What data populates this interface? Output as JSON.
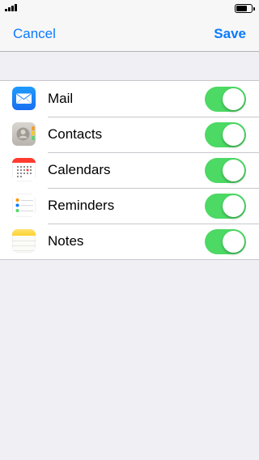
{
  "nav": {
    "cancel_label": "Cancel",
    "save_label": "Save"
  },
  "accent_color": "#0a7aff",
  "toggle_on_color": "#4cd964",
  "items": [
    {
      "label": "Mail",
      "icon": "mail-icon",
      "enabled": true
    },
    {
      "label": "Contacts",
      "icon": "contacts-icon",
      "enabled": true
    },
    {
      "label": "Calendars",
      "icon": "calendar-icon",
      "enabled": true
    },
    {
      "label": "Reminders",
      "icon": "reminders-icon",
      "enabled": true
    },
    {
      "label": "Notes",
      "icon": "notes-icon",
      "enabled": true
    }
  ]
}
